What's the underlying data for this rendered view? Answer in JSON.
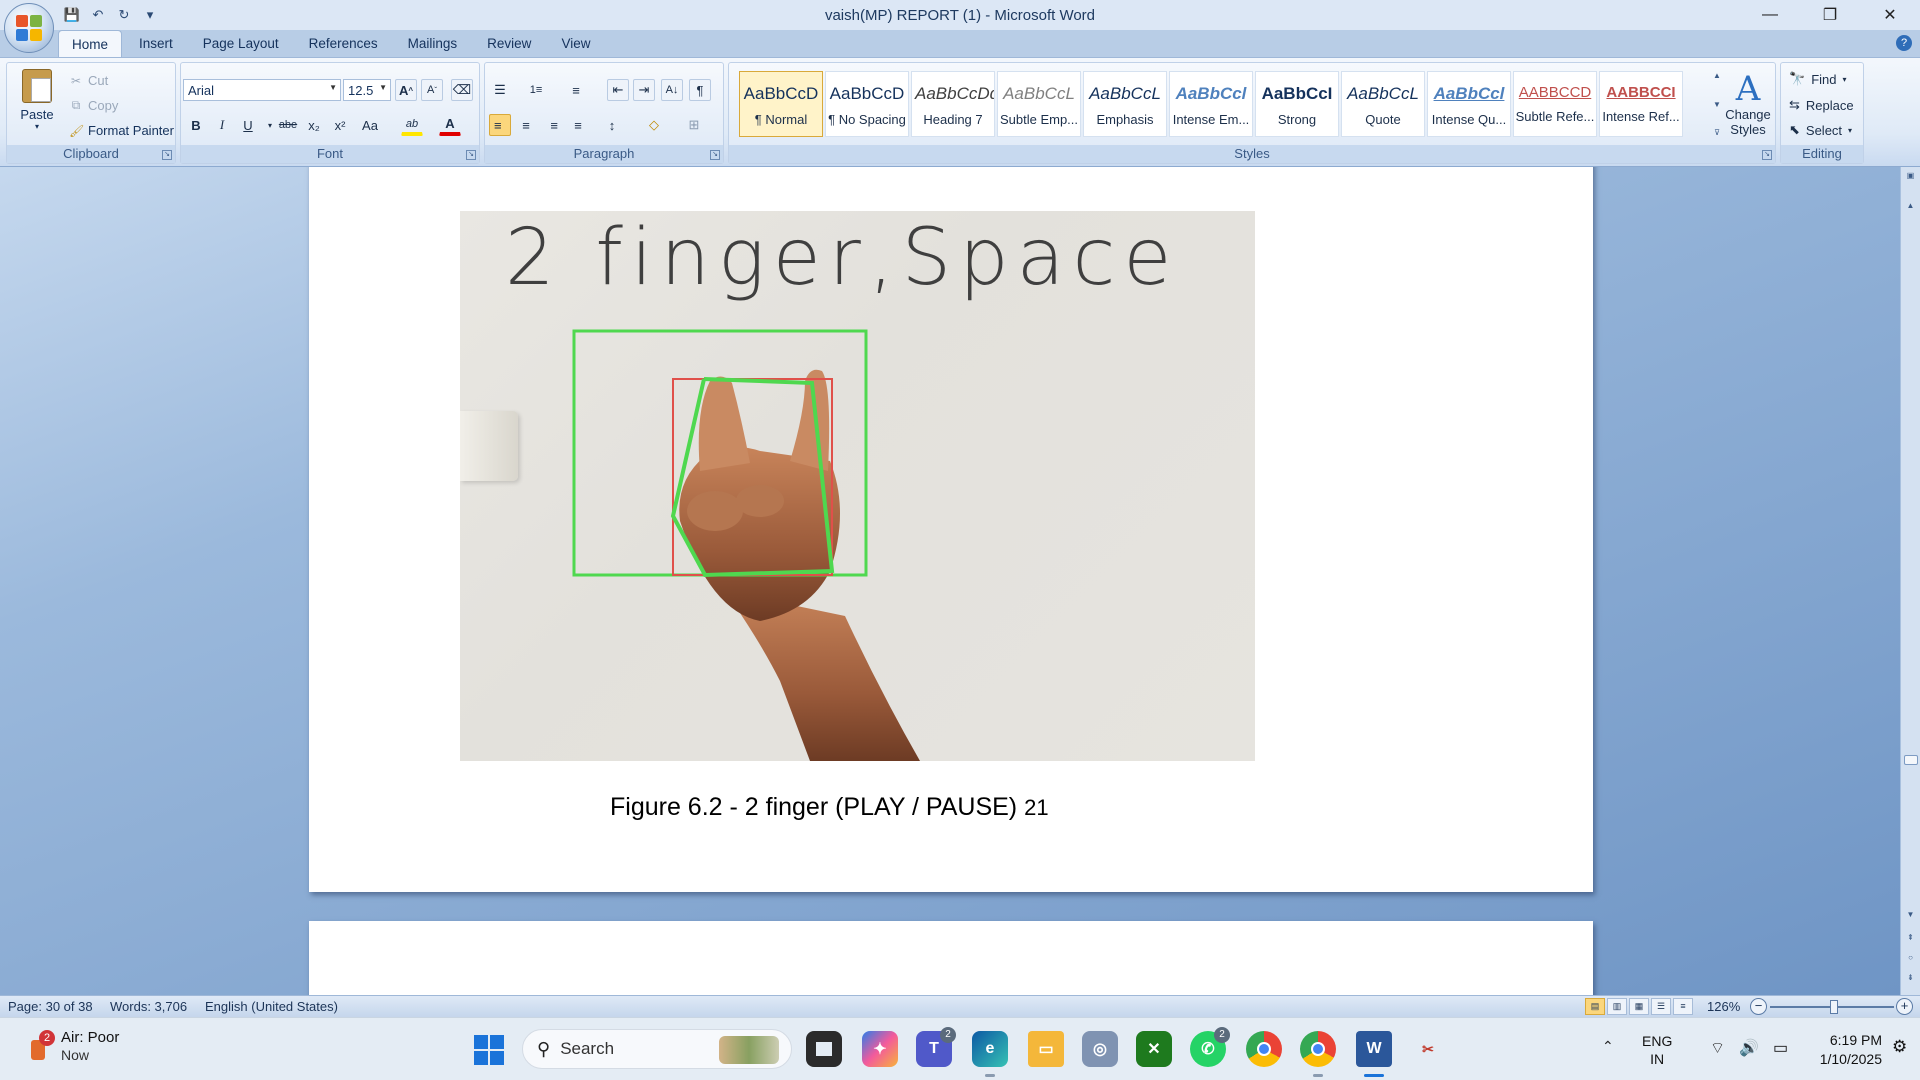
{
  "window": {
    "title": "vaish(MP) REPORT (1) - Microsoft Word",
    "minimize": "—",
    "restore": "❐",
    "close": "✕"
  },
  "qat": {
    "save": "💾",
    "undo": "↶",
    "redo": "↻",
    "customize": "▾"
  },
  "tabs": [
    "Home",
    "Insert",
    "Page Layout",
    "References",
    "Mailings",
    "Review",
    "View"
  ],
  "help": "?",
  "clipboard": {
    "paste": "Paste",
    "cut": "Cut",
    "copy": "Copy",
    "format_painter": "Format Painter",
    "label": "Clipboard"
  },
  "font": {
    "name": "Arial",
    "size": "12.5",
    "grow": "A",
    "shrink": "A",
    "clear": "⌫",
    "bold": "B",
    "italic": "I",
    "underline": "U",
    "strike": "abe",
    "subscript": "x₂",
    "superscript": "x²",
    "change_case": "Aa",
    "highlight": "ab",
    "color": "A",
    "label": "Font"
  },
  "paragraph": {
    "bullets": "☰",
    "numbering": "1≡",
    "multilevel": "≡",
    "decrease_indent": "⇤",
    "increase_indent": "⇥",
    "sort": "A↓",
    "show_marks": "¶",
    "align_left": "≡",
    "center": "≡",
    "align_right": "≡",
    "justify": "≡",
    "line_spacing": "↕",
    "shading": "◇",
    "borders": "⊞",
    "label": "Paragraph"
  },
  "styles": {
    "items": [
      {
        "sample": "AaBbCcD",
        "name": "¶ Normal"
      },
      {
        "sample": "AaBbCcD",
        "name": "¶ No Spacing"
      },
      {
        "sample": "AaBbCcDd",
        "name": "Heading 7"
      },
      {
        "sample": "AaBbCcL",
        "name": "Subtle Emp..."
      },
      {
        "sample": "AaBbCcL",
        "name": "Emphasis"
      },
      {
        "sample": "AaBbCcl",
        "name": "Intense Em..."
      },
      {
        "sample": "AaBbCcI",
        "name": "Strong"
      },
      {
        "sample": "AaBbCcL",
        "name": "Quote"
      },
      {
        "sample": "AaBbCcl",
        "name": "Intense Qu..."
      },
      {
        "sample": "AABBCCD",
        "name": "Subtle Refe..."
      },
      {
        "sample": "AABBCCI",
        "name": "Intense Ref..."
      }
    ],
    "change_styles_icon": "A",
    "change_styles": "Change Styles",
    "label": "Styles"
  },
  "editing": {
    "find": "Find",
    "replace": "Replace",
    "select": "Select",
    "label": "Editing"
  },
  "document": {
    "figure_text": "2  finger,Space",
    "caption": "Figure 6.2 - 2 finger (PLAY / PAUSE)",
    "page_number": "21"
  },
  "statusbar": {
    "page": "Page: 30 of 38",
    "words": "Words: 3,706",
    "language": "English (United States)",
    "zoom": "126%"
  },
  "taskbar": {
    "weather_badge": "2",
    "weather": "Air: Poor",
    "weather_time": "Now",
    "search": "Search",
    "teams_badge": "2",
    "whatsapp_badge": "2",
    "lang_1": "ENG",
    "lang_2": "IN",
    "time": "6:19 PM",
    "date": "1/10/2025"
  },
  "colors": {
    "ribbon": "#dfeaf7",
    "doc_bg": "#6f95c5",
    "outer_box": "#4fd84f",
    "inner_box": "#e0504a",
    "accent": "#1a73d9"
  }
}
